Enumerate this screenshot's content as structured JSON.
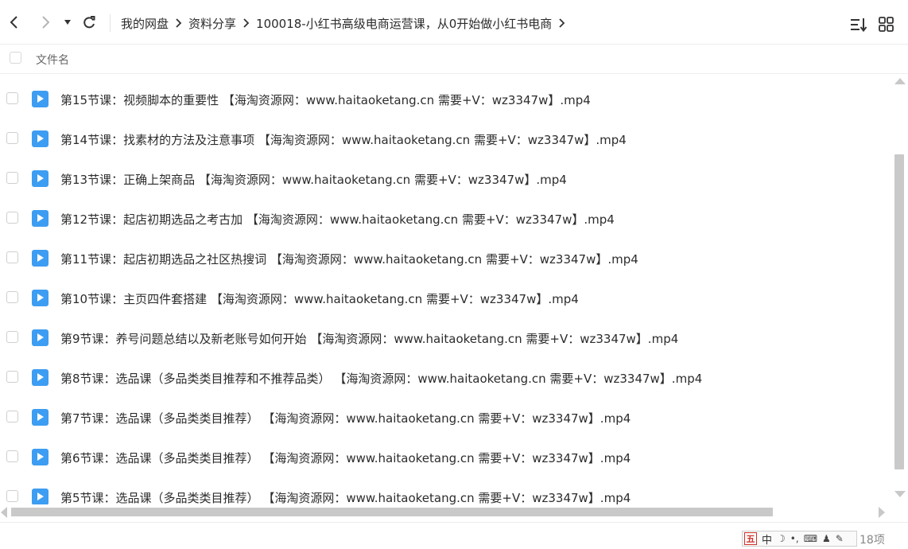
{
  "toolbar": {
    "back_icon": "chevron-left-icon",
    "forward_icon": "chevron-right-icon",
    "history_icon": "caret-down-icon",
    "refresh_icon": "refresh-icon",
    "sort_icon": "sort-list-icon",
    "grid_icon": "grid-view-icon"
  },
  "breadcrumb": [
    {
      "label": "我的网盘"
    },
    {
      "label": "资料分享"
    },
    {
      "label": "100018-小红书高级电商运营课，从0开始做小红书电商"
    }
  ],
  "header": {
    "name_label": "文件名"
  },
  "files": [
    {
      "name": "第15节课：视频脚本的重要性 【海淘资源网：www.haitaoketang.cn 需要+V：wz3347w】.mp4"
    },
    {
      "name": "第14节课：找素材的方法及注意事项 【海淘资源网：www.haitaoketang.cn 需要+V：wz3347w】.mp4"
    },
    {
      "name": "第13节课：正确上架商品 【海淘资源网：www.haitaoketang.cn 需要+V：wz3347w】.mp4"
    },
    {
      "name": "第12节课：起店初期选品之考古加 【海淘资源网：www.haitaoketang.cn 需要+V：wz3347w】.mp4"
    },
    {
      "name": "第11节课：起店初期选品之社区热搜词 【海淘资源网：www.haitaoketang.cn 需要+V：wz3347w】.mp4"
    },
    {
      "name": "第10节课：主页四件套搭建 【海淘资源网：www.haitaoketang.cn 需要+V：wz3347w】.mp4"
    },
    {
      "name": "第9节课：养号问题总结以及新老账号如何开始 【海淘资源网：www.haitaoketang.cn 需要+V：wz3347w】.mp4"
    },
    {
      "name": "第8节课：选品课（多品类类目推荐和不推荐品类） 【海淘资源网：www.haitaoketang.cn 需要+V：wz3347w】.mp4"
    },
    {
      "name": "第7节课：选品课（多品类类目推荐） 【海淘资源网：www.haitaoketang.cn 需要+V：wz3347w】.mp4"
    },
    {
      "name": "第6节课：选品课（多品类类目推荐） 【海淘资源网：www.haitaoketang.cn 需要+V：wz3347w】.mp4"
    },
    {
      "name": "第5节课：选品课（多品类类目推荐） 【海淘资源网：www.haitaoketang.cn 需要+V：wz3347w】.mp4"
    }
  ],
  "file_icon": "video-file-icon",
  "colors": {
    "accent": "#3d9df2"
  },
  "status": {
    "ime_logo": "五",
    "ime_mode": "中",
    "item_count": "18项"
  }
}
